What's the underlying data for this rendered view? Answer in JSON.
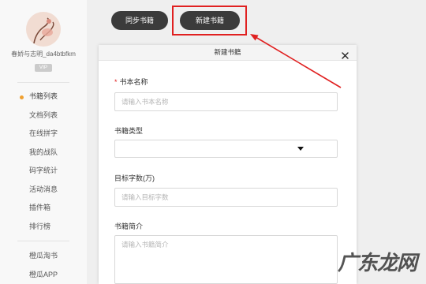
{
  "sidebar": {
    "username": "春娇与志明_da4btbfkm",
    "vip_label": "VIP",
    "menu": [
      {
        "label": "书籍列表",
        "active": true
      },
      {
        "label": "文档列表"
      },
      {
        "label": "在线拼字"
      },
      {
        "label": "我的战队"
      },
      {
        "label": "码字统计"
      },
      {
        "label": "活动消息"
      },
      {
        "label": "插件箱"
      },
      {
        "label": "排行榜"
      }
    ],
    "extra": [
      {
        "label": "橙瓜淘书"
      },
      {
        "label": "橙瓜APP"
      }
    ]
  },
  "toolbar": {
    "sync_label": "同步书籍",
    "new_label": "新建书籍"
  },
  "dialog": {
    "title": "新建书籍",
    "form": {
      "required_mark": "*",
      "book_name": {
        "label": "书本名称",
        "placeholder": "请输入书本名称"
      },
      "book_type": {
        "label": "书籍类型"
      },
      "target_words": {
        "label": "目标字数(万)",
        "placeholder": "请输入目标字数"
      },
      "intro": {
        "label": "书籍简介",
        "placeholder": "请输入书籍简介"
      }
    }
  },
  "watermark": "广东龙网",
  "icons": {
    "close": "close-icon",
    "dropdown": "chevron-down-icon",
    "arrow": "annotation-arrow-icon"
  },
  "colors": {
    "button_bg": "#3b3b3b",
    "highlight": "#e02020",
    "active_dot": "#f0a030",
    "required": "#e02020"
  }
}
